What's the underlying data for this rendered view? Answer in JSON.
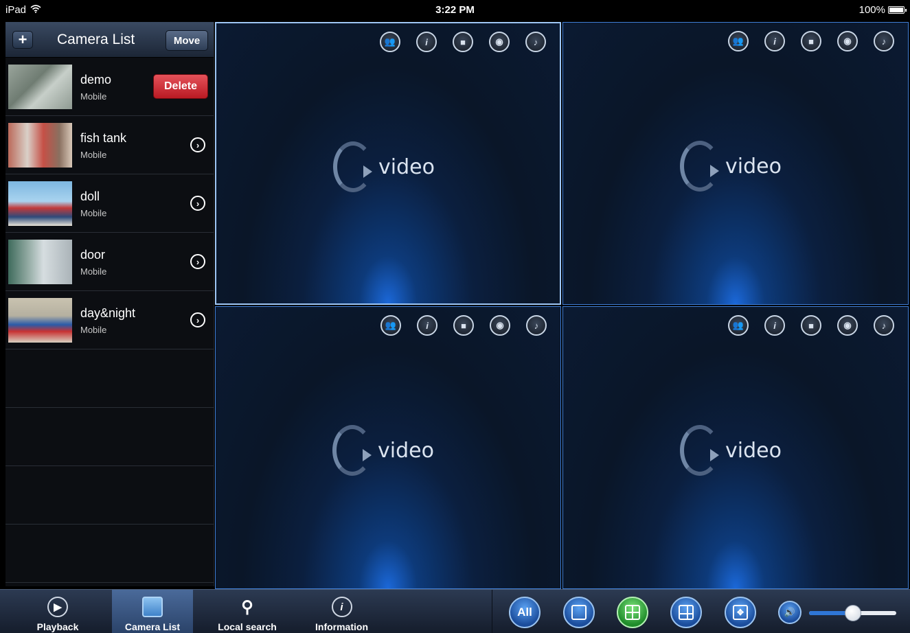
{
  "status_bar": {
    "device": "iPad",
    "time": "3:22 PM",
    "battery": "100%"
  },
  "sidebar": {
    "add_label": "+",
    "title": "Camera List",
    "move_label": "Move",
    "cameras": [
      {
        "name": "demo",
        "type": "Mobile",
        "action": "Delete"
      },
      {
        "name": "fish tank",
        "type": "Mobile",
        "action": "›"
      },
      {
        "name": "doll",
        "type": "Mobile",
        "action": "›"
      },
      {
        "name": "door",
        "type": "Mobile",
        "action": "›"
      },
      {
        "name": "day&night",
        "type": "Mobile",
        "action": "›"
      }
    ]
  },
  "video_panels": [
    {
      "label": "video",
      "icons": [
        "people-icon",
        "info-icon",
        "record-icon",
        "snapshot-icon",
        "mic-icon"
      ]
    },
    {
      "label": "video",
      "icons": [
        "people-icon",
        "info-icon",
        "record-icon",
        "snapshot-icon",
        "mic-icon"
      ]
    },
    {
      "label": "video",
      "icons": [
        "people-icon",
        "info-icon",
        "record-icon",
        "snapshot-icon",
        "mic-icon"
      ]
    },
    {
      "label": "video",
      "icons": [
        "people-icon",
        "info-icon",
        "record-icon",
        "snapshot-icon",
        "mic-icon"
      ]
    }
  ],
  "toolbar": {
    "tabs": [
      {
        "label": "Playback",
        "icon": "playback-icon"
      },
      {
        "label": "Camera List",
        "icon": "camera-list-icon"
      },
      {
        "label": "Local search",
        "icon": "search-icon"
      },
      {
        "label": "Information",
        "icon": "info-icon"
      }
    ],
    "active_tab": "Camera List",
    "view_buttons": {
      "all_label": "All"
    },
    "selected_view": "4-grid",
    "volume": 0.5
  },
  "colors": {
    "accent": "#3f7ed6",
    "delete": "#c8262f",
    "selected_view": "#2fa83a"
  }
}
